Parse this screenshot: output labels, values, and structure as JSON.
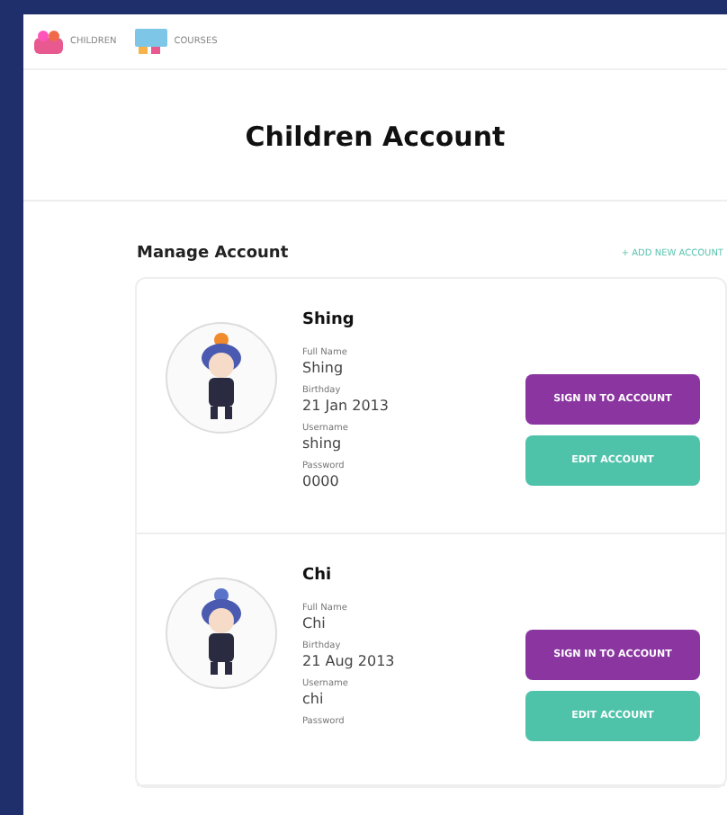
{
  "nav": {
    "items": [
      {
        "label": "CHILDREN",
        "kind": "children"
      },
      {
        "label": "COURSES",
        "kind": "courses"
      }
    ]
  },
  "title": "Children Account",
  "section": {
    "heading": "Manage Account",
    "action": "+ ADD NEW ACCOUNT"
  },
  "accounts": [
    {
      "name": "Shing",
      "fields": [
        {
          "label": "Full Name",
          "value": "Shing"
        },
        {
          "label": "Birthday",
          "value": "21 Jan 2013"
        },
        {
          "label": "Username",
          "value": "shing"
        },
        {
          "label": "Password",
          "value": "0000"
        }
      ],
      "color": "#f08a2a",
      "buttons": [
        {
          "label": "SIGN IN TO ACCOUNT",
          "kind": "primary"
        },
        {
          "label": "EDIT ACCOUNT",
          "kind": "secondary"
        }
      ]
    },
    {
      "name": "Chi",
      "fields": [
        {
          "label": "Full Name",
          "value": "Chi"
        },
        {
          "label": "Birthday",
          "value": "21 Aug 2013"
        },
        {
          "label": "Username",
          "value": "chi"
        },
        {
          "label": "Password"
        }
      ],
      "color": "#5a72c8",
      "buttons": [
        {
          "label": "SIGN IN TO ACCOUNT",
          "kind": "primary"
        },
        {
          "label": "EDIT ACCOUNT",
          "kind": "secondary"
        }
      ]
    }
  ]
}
